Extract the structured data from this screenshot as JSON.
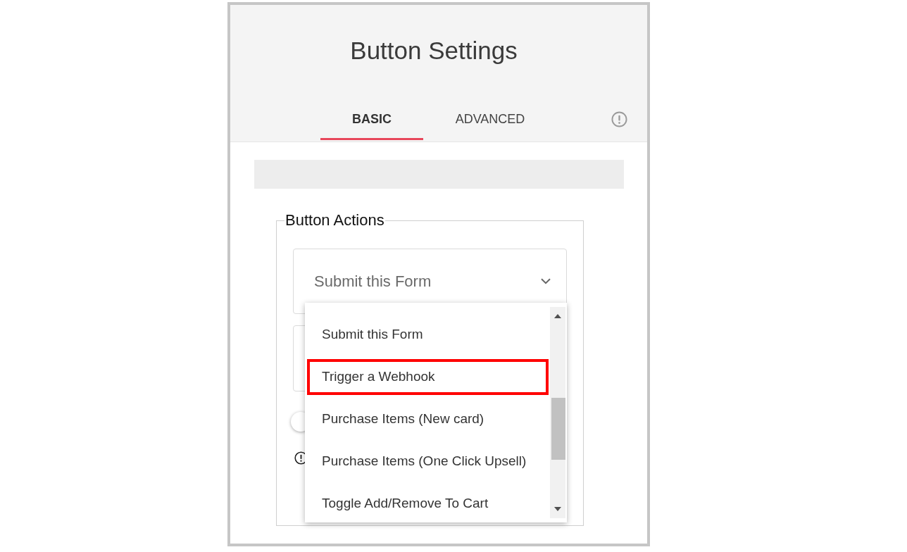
{
  "panel": {
    "title": "Button Settings"
  },
  "tabs": [
    {
      "label": "BASIC",
      "selected": true
    },
    {
      "label": "ADVANCED",
      "selected": false
    }
  ],
  "button_actions": {
    "legend": "Button Actions",
    "action_select": {
      "value": "Submit this Form",
      "expanded": true
    },
    "options": [
      {
        "label": "Submit this Form",
        "highlighted": false
      },
      {
        "label": "Trigger a Webhook",
        "highlighted": true
      },
      {
        "label": "Purchase Items (New card)",
        "highlighted": false
      },
      {
        "label": "Purchase Items (One Click Upsell)",
        "highlighted": false
      },
      {
        "label": "Toggle Add/Remove To Cart",
        "highlighted": false
      }
    ],
    "toggle": {
      "on": false
    }
  }
}
